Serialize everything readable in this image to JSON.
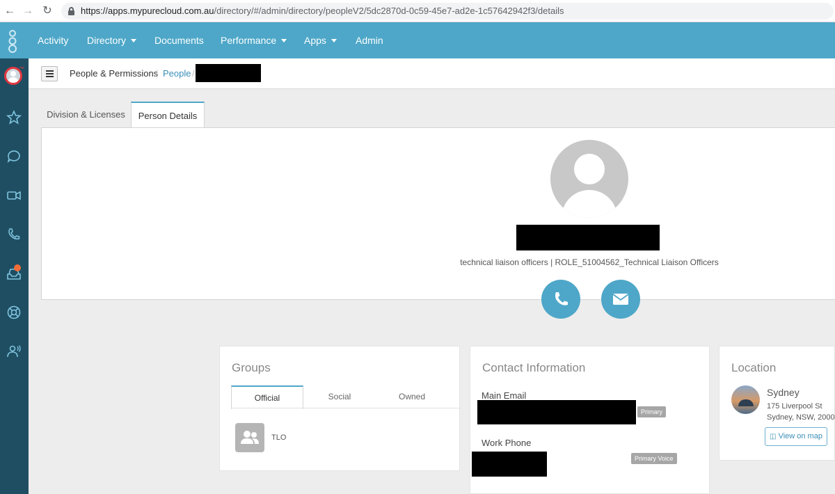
{
  "browser": {
    "url_host": "https://apps.mypurecloud.com.au",
    "url_path": "/directory/#/admin/directory/peopleV2/5dc2870d-0c59-45e7-ad2e-1c57642942f3/details"
  },
  "topnav": {
    "items": [
      {
        "label": "Activity",
        "dropdown": false
      },
      {
        "label": "Directory",
        "dropdown": true
      },
      {
        "label": "Documents",
        "dropdown": false
      },
      {
        "label": "Performance",
        "dropdown": true
      },
      {
        "label": "Apps",
        "dropdown": true
      },
      {
        "label": "Admin",
        "dropdown": false
      }
    ],
    "color": "#4ea7c8"
  },
  "sidebar": {
    "icons": [
      "avatar",
      "star-icon",
      "chat-icon",
      "video-icon",
      "phone-icon",
      "inbox-icon",
      "help-icon",
      "voice-icon"
    ],
    "color": "#1f4e63"
  },
  "breadcrumb": {
    "items": [
      "People & Permissions",
      "People"
    ],
    "separator": "/"
  },
  "tabs": [
    "Division & Licenses",
    "Person Details"
  ],
  "profile": {
    "role": "technical liaison officers | ROLE_51004562_Technical Liaison Officers"
  },
  "groups": {
    "title": "Groups",
    "tabs": [
      "Official",
      "Social",
      "Owned"
    ],
    "items": [
      {
        "name": "TLO"
      }
    ]
  },
  "contact": {
    "title": "Contact Information",
    "main_email_label": "Main Email",
    "main_email_badge": "Primary",
    "work_phone_label": "Work Phone",
    "work_phone_badge": "Primary Voice"
  },
  "location": {
    "title": "Location",
    "city": "Sydney",
    "address_line1": "175 Liverpool St",
    "address_line2": "Sydney, NSW, 2000,",
    "map_button": "View on map"
  }
}
